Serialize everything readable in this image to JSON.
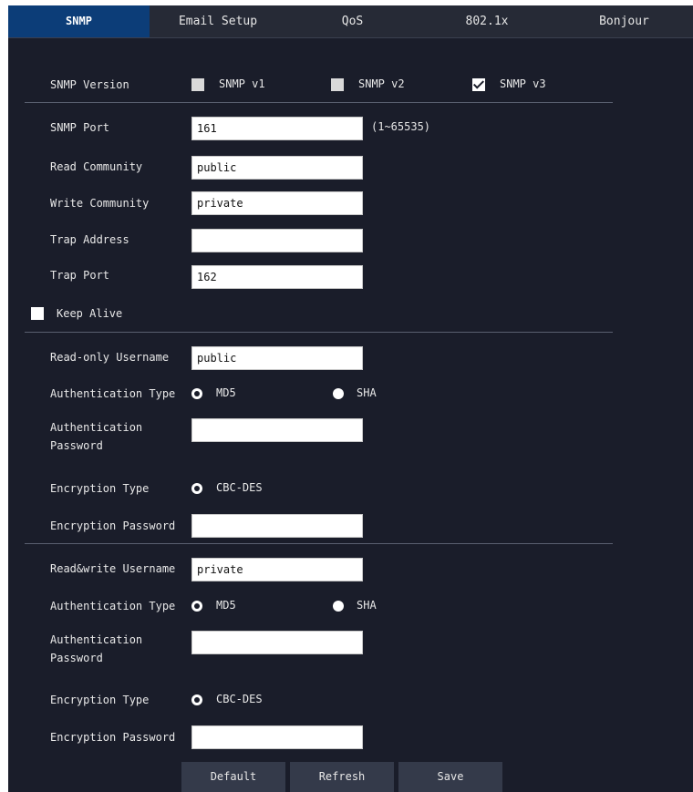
{
  "tabs": [
    "SNMP",
    "Email Setup",
    "QoS",
    "802.1x",
    "Bonjour"
  ],
  "snmp_version": {
    "label": "SNMP Version",
    "options": [
      {
        "label": "SNMP v1",
        "checked": false
      },
      {
        "label": "SNMP v2",
        "checked": false
      },
      {
        "label": "SNMP v3",
        "checked": true
      }
    ]
  },
  "fields": {
    "snmp_port": {
      "label": "SNMP Port",
      "value": "161",
      "hint": "(1~65535)"
    },
    "read_community": {
      "label": "Read Community",
      "value": "public"
    },
    "write_community": {
      "label": "Write Community",
      "value": "private"
    },
    "trap_address": {
      "label": "Trap Address",
      "value": ""
    },
    "trap_port": {
      "label": "Trap Port",
      "value": "162"
    }
  },
  "keep_alive": {
    "label": "Keep Alive",
    "checked": false
  },
  "readonly": {
    "username_label": "Read-only Username",
    "username_value": "public",
    "auth_type_label": "Authentication Type",
    "auth_options": [
      "MD5",
      "SHA"
    ],
    "auth_selected": "MD5",
    "auth_password_label_1": "Authentication",
    "auth_password_label_2": "Password",
    "auth_password_value": "",
    "enc_type_label": "Encryption Type",
    "enc_option": "CBC-DES",
    "enc_password_label": "Encryption Password",
    "enc_password_value": ""
  },
  "readwrite": {
    "username_label": "Read&write Username",
    "username_value": "private",
    "auth_type_label": "Authentication Type",
    "auth_options": [
      "MD5",
      "SHA"
    ],
    "auth_selected": "MD5",
    "auth_password_label_1": "Authentication",
    "auth_password_label_2": "Password",
    "auth_password_value": "",
    "enc_type_label": "Encryption Type",
    "enc_option": "CBC-DES",
    "enc_password_label": "Encryption Password",
    "enc_password_value": ""
  },
  "buttons": {
    "default": "Default",
    "refresh": "Refresh",
    "save": "Save"
  },
  "colors": {
    "background": "#1a1d2a",
    "tab_active": "#0c3d78",
    "button": "#343a4a"
  }
}
